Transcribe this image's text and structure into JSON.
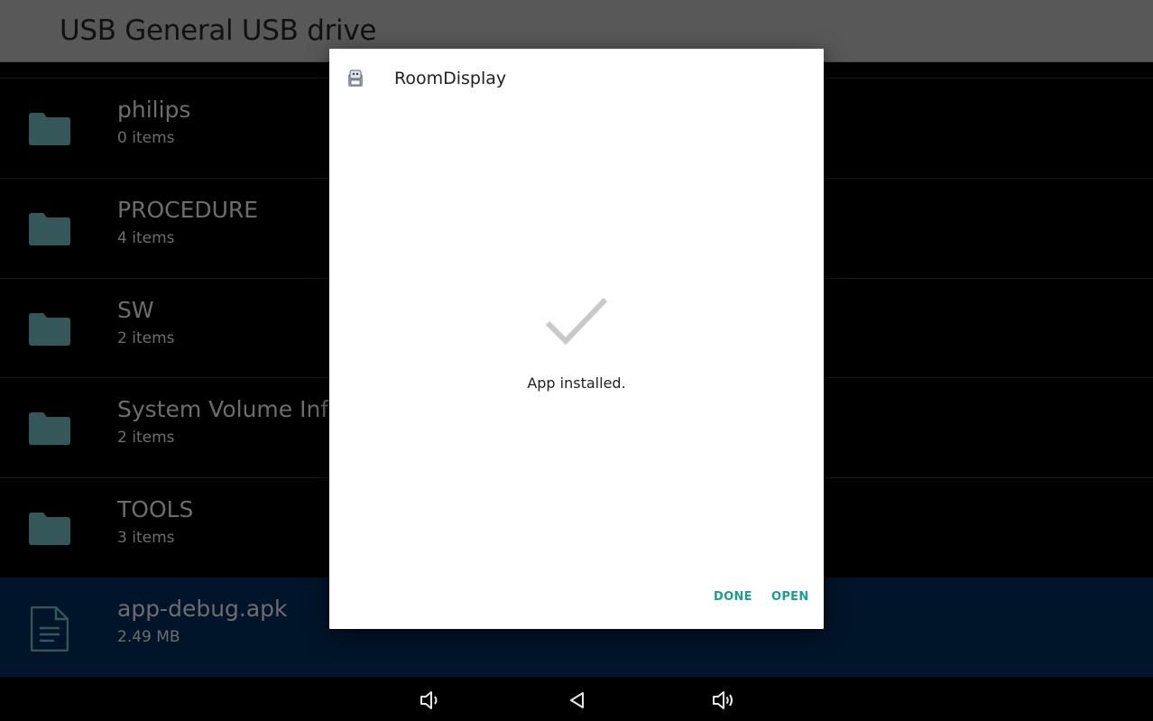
{
  "appbar": {
    "title": "USB General USB drive"
  },
  "files": [
    {
      "name": "philips",
      "meta": "0 items",
      "kind": "folder"
    },
    {
      "name": "PROCEDURE",
      "meta": "4 items",
      "kind": "folder"
    },
    {
      "name": "SW",
      "meta": "2 items",
      "kind": "folder"
    },
    {
      "name": "System Volume Infor",
      "meta": "2 items",
      "kind": "folder"
    },
    {
      "name": "TOOLS",
      "meta": "3 items",
      "kind": "folder"
    },
    {
      "name": "app-debug.apk",
      "meta": "2.49 MB",
      "kind": "file",
      "selected": true
    }
  ],
  "dialog": {
    "app_name": "RoomDisplay",
    "app_icon": "android-app-icon",
    "status_icon": "checkmark-icon",
    "message": "App installed.",
    "done_label": "DONE",
    "open_label": "OPEN"
  },
  "navbar": {
    "buttons": [
      "volume-down-icon",
      "back-icon",
      "volume-up-icon"
    ]
  },
  "colors": {
    "appbar": "#585858",
    "folder": "#34575a",
    "selected_row": "#00152a",
    "accent": "#1a9e8f",
    "check": "#c9c9c9"
  }
}
